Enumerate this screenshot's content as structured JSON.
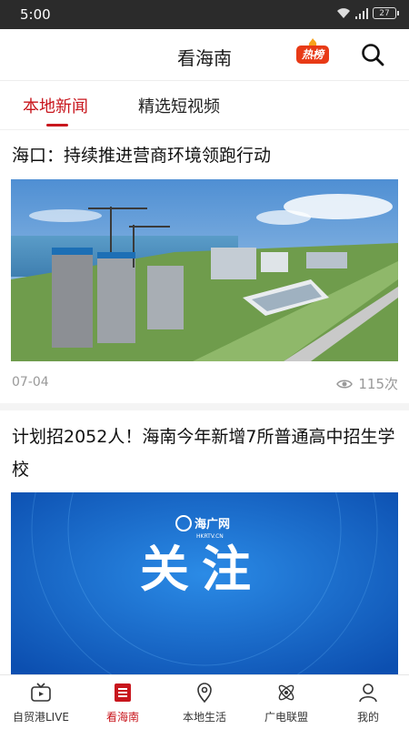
{
  "status_bar": {
    "time": "5:00",
    "battery": "27"
  },
  "header": {
    "title": "看海南",
    "hot_badge": "热榜",
    "icons": [
      "flame-icon",
      "search-icon"
    ]
  },
  "tabs": [
    {
      "label": "本地新闻",
      "active": true
    },
    {
      "label": "精选短视频",
      "active": false
    }
  ],
  "articles": [
    {
      "title": "海口：持续推进营商环境领跑行动",
      "date": "07-04",
      "views": "115次",
      "image": "construction-aerial-photo"
    },
    {
      "title": "计划招2052人！海南今年新增7所普通高中招生学校",
      "image": "haiguang-banner",
      "banner_logo": "海广网",
      "banner_logo_sub": "HKRTV.CN",
      "banner_text": "关注"
    }
  ],
  "bottom_nav": [
    {
      "label": "自贸港LIVE",
      "icon": "tv-icon",
      "active": false
    },
    {
      "label": "看海南",
      "icon": "list-icon",
      "active": true
    },
    {
      "label": "本地生活",
      "icon": "location-pin-icon",
      "active": false
    },
    {
      "label": "广电联盟",
      "icon": "atom-icon",
      "active": false
    },
    {
      "label": "我的",
      "icon": "person-icon",
      "active": false
    }
  ],
  "colors": {
    "accent": "#c8161d",
    "badge": "#e83a16",
    "status_bar": "#2b2b2b"
  }
}
